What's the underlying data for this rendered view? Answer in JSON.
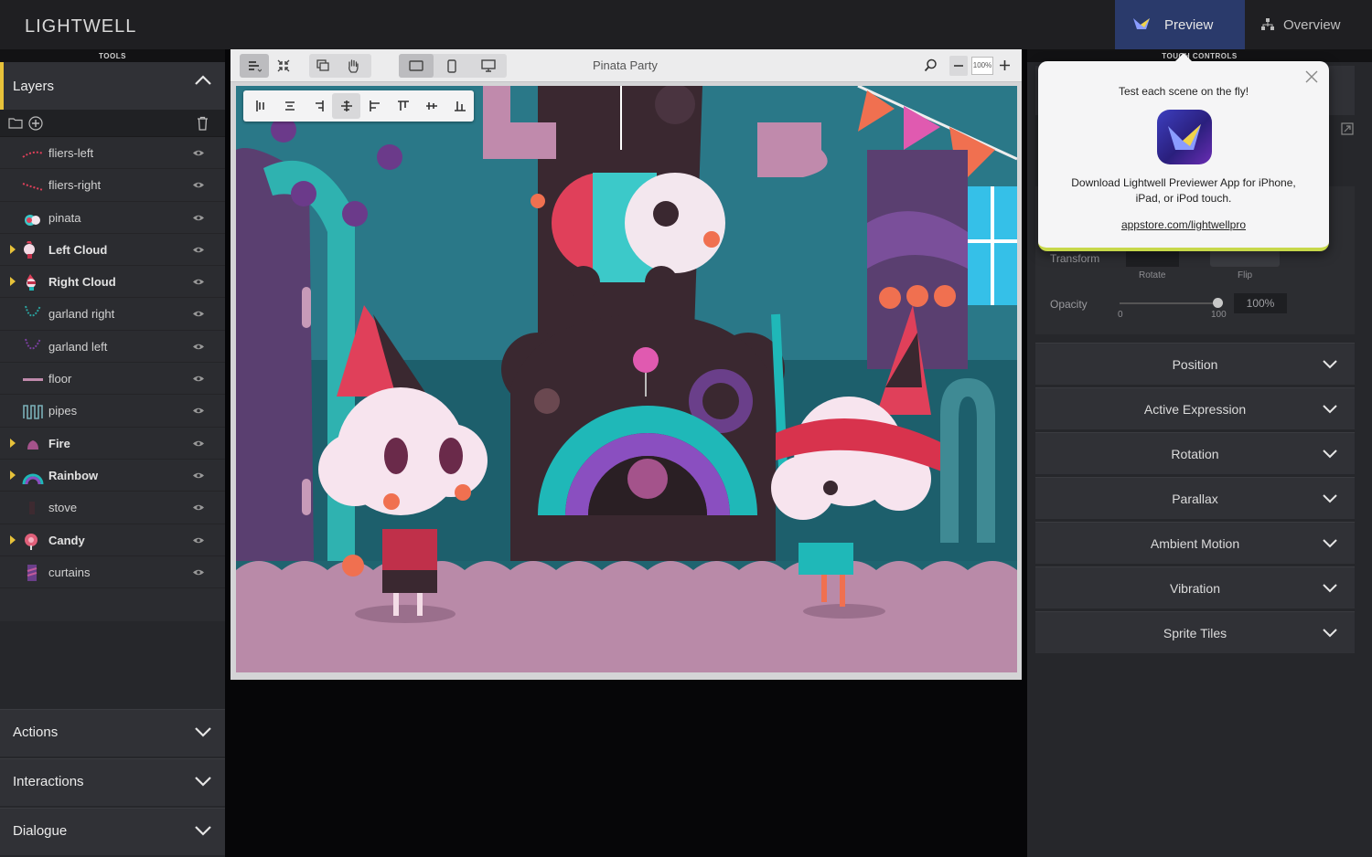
{
  "app": {
    "brand": "LIGHTWELL"
  },
  "top_tabs": {
    "preview": "Preview",
    "overview": "Overview"
  },
  "left_panel": {
    "tools_label": "TOOLS",
    "layers_title": "Layers",
    "layers": [
      {
        "name": "fliers-left",
        "group": false
      },
      {
        "name": "fliers-right",
        "group": false
      },
      {
        "name": "pinata",
        "group": false
      },
      {
        "name": "Left Cloud",
        "group": true
      },
      {
        "name": "Right Cloud",
        "group": true
      },
      {
        "name": "garland right",
        "group": false
      },
      {
        "name": "garland left",
        "group": false
      },
      {
        "name": "floor",
        "group": false
      },
      {
        "name": "pipes",
        "group": false
      },
      {
        "name": "Fire",
        "group": true
      },
      {
        "name": "Rainbow",
        "group": true
      },
      {
        "name": "stove",
        "group": false
      },
      {
        "name": "Candy",
        "group": true
      },
      {
        "name": "curtains",
        "group": false
      }
    ],
    "sections": [
      "Actions",
      "Interactions",
      "Dialogue"
    ]
  },
  "canvas": {
    "title": "Pinata Party",
    "zoom": "100%"
  },
  "right_panel": {
    "top_label": "TOUCH CONTROLS",
    "transform_label": "Transform",
    "rotate_label": "Rotate",
    "flip_label": "Flip",
    "opacity_label": "Opacity",
    "opacity_min": "0",
    "opacity_max": "100",
    "opacity_value": "100%",
    "opacity_level": 1.0,
    "sections": [
      "Position",
      "Active Expression",
      "Rotation",
      "Parallax",
      "Ambient Motion",
      "Vibration",
      "Sprite Tiles"
    ]
  },
  "popover": {
    "heading": "Test each scene on the fly!",
    "body": "Download Lightwell Previewer App for iPhone, iPad, or iPod touch.",
    "link": "appstore.com/lightwellpro"
  },
  "colors": {
    "accent": "#e7c23a",
    "preview_tab": "#2a3a6b",
    "panel": "#26272b"
  }
}
